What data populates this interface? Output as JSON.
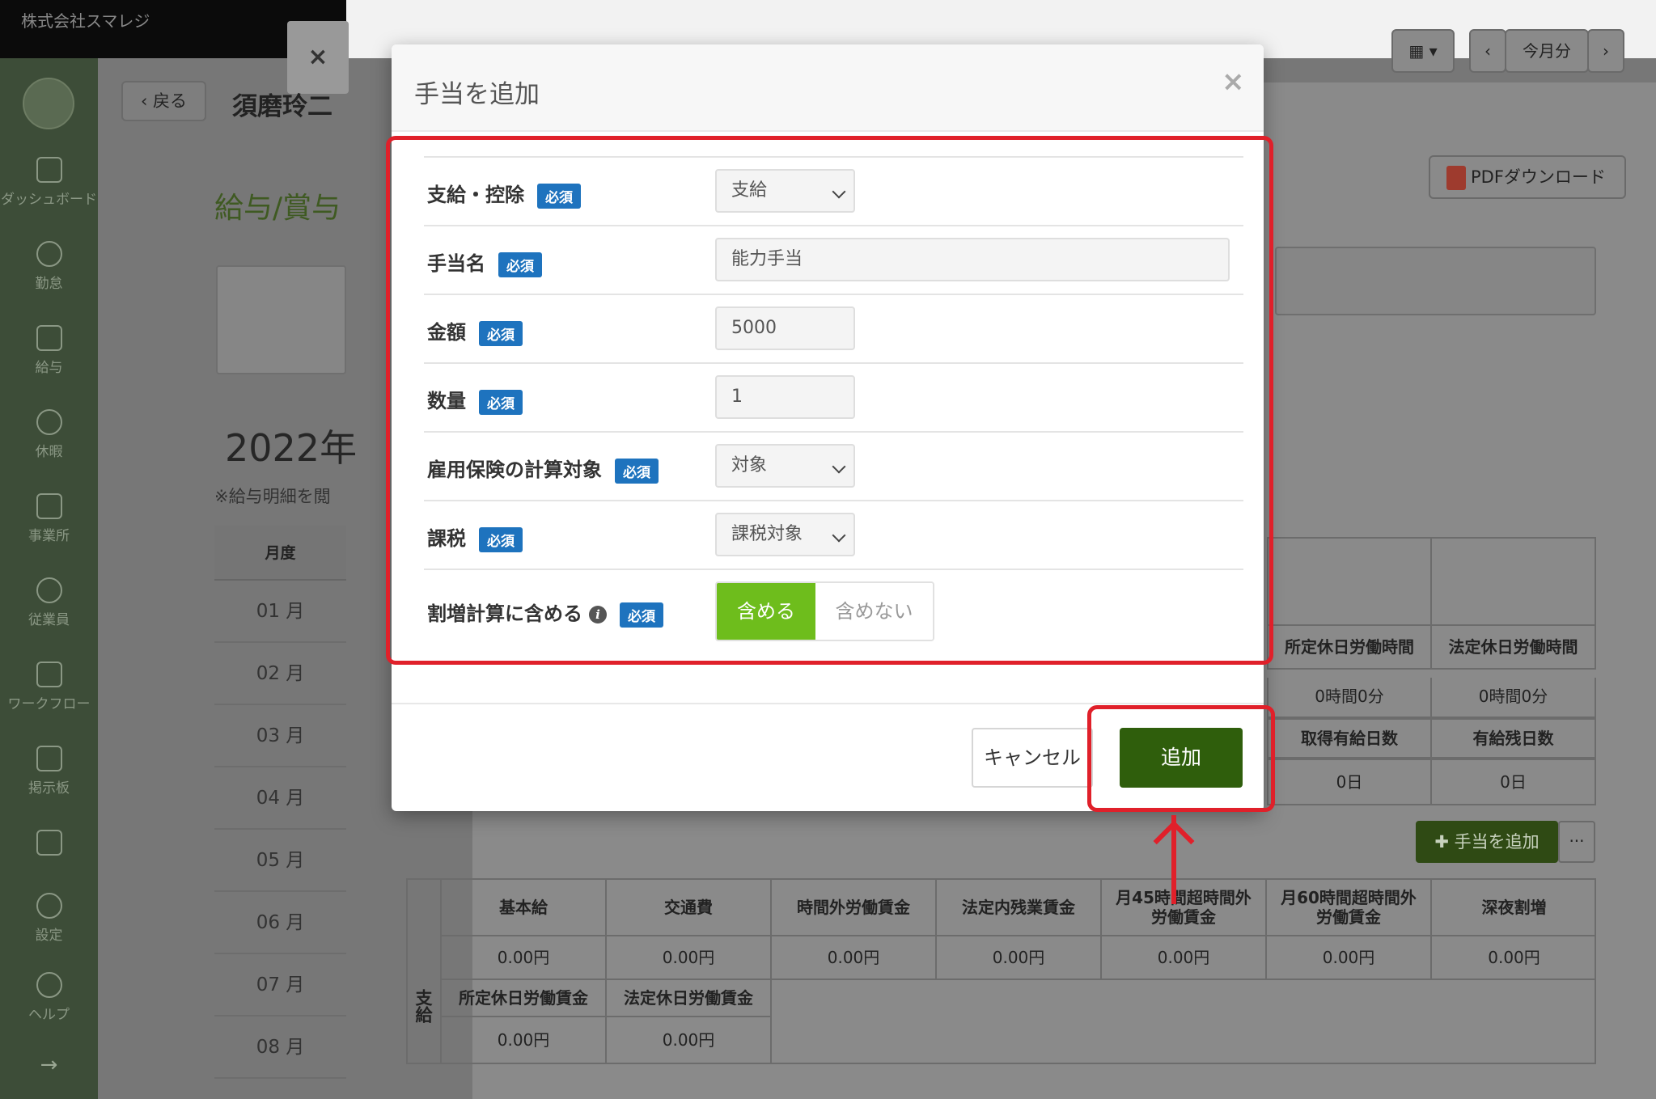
{
  "company": "株式会社スマレジ",
  "sidebar": {
    "items": [
      {
        "label": "ダッシュボード",
        "icon": "dashboard-icon"
      },
      {
        "label": "勤怠",
        "icon": "clock-icon"
      },
      {
        "label": "給与",
        "icon": "calculator-icon"
      },
      {
        "label": "休暇",
        "icon": "umbrella-icon"
      },
      {
        "label": "事業所",
        "icon": "home-icon"
      },
      {
        "label": "従業員",
        "icon": "person-icon"
      },
      {
        "label": "ワークフロー",
        "icon": "workflow-icon"
      },
      {
        "label": "掲示板",
        "icon": "board-icon"
      },
      {
        "label": "",
        "icon": "flag-icon"
      },
      {
        "label": "設定",
        "icon": "gear-icon"
      },
      {
        "label": "ヘルプ",
        "icon": "help-icon"
      }
    ],
    "expand_icon": "→"
  },
  "underlay": {
    "close_label": "×",
    "back_label": "戻る",
    "employee_name": "須磨玲二",
    "section_title": "給与/賞与",
    "year_title": "2022年",
    "note": "※給与明細を閲",
    "month_header": "月度",
    "months": [
      "01 月",
      "02 月",
      "03 月",
      "04 月",
      "05 月",
      "06 月",
      "07 月",
      "08 月"
    ],
    "calendar_label": "▾",
    "prev_label": "‹",
    "current_month_label": "今月分",
    "next_label": "›",
    "pdf_label": "PDFダウンロード",
    "stats": {
      "h1": "所定休日労働時間",
      "h2": "法定休日労働時間",
      "v1": "0時間0分",
      "v2": "0時間0分",
      "h3": "取得有給日数",
      "h4": "有給残日数",
      "v3": "0日",
      "v4": "0日"
    },
    "add_allowance_label": "手当を追加",
    "more_label": "···",
    "pay_side_label": "支給",
    "pay_headers": [
      "基本給",
      "交通費",
      "時間外労働賃金",
      "法定内残業賃金",
      "月45時間超時間外労働賃金",
      "月60時間超時間外労働賃金",
      "深夜割増"
    ],
    "pay_values": [
      "0.00円",
      "0.00円",
      "0.00円",
      "0.00円",
      "0.00円",
      "0.00円",
      "0.00円"
    ],
    "pay_headers2": [
      "所定休日労働賃金",
      "法定休日労働賃金"
    ],
    "pay_values2": [
      "0.00円",
      "0.00円"
    ]
  },
  "modal": {
    "title": "手当を追加",
    "close": "×",
    "required_badge": "必須",
    "fields": [
      {
        "label": "支給・控除",
        "value": "支給"
      },
      {
        "label": "手当名",
        "value": "能力手当"
      },
      {
        "label": "金額",
        "value": "5000"
      },
      {
        "label": "数量",
        "value": "1"
      },
      {
        "label": "雇用保険の計算対象",
        "value": "対象"
      },
      {
        "label": "課税",
        "value": "課税対象"
      },
      {
        "label": "割増計算に含める",
        "info": "i"
      }
    ],
    "toggle_on": "含める",
    "toggle_off": "含めない",
    "cancel_label": "キャンセル",
    "add_label": "追加"
  },
  "colors": {
    "accent_green": "#6ebd1c",
    "primary_dark_green": "#2f5e0c",
    "required_blue": "#1e73be",
    "highlight_red": "#e0202a"
  }
}
